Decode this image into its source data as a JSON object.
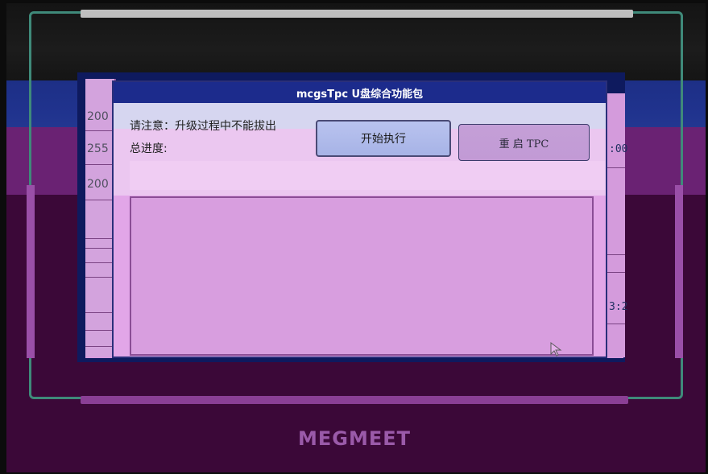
{
  "dialog": {
    "title": "mcgsTpc U盘综合功能包",
    "warning": "请注意：升级过程中不能拔出",
    "progress_label": "总进度:",
    "start_button": "开始执行",
    "restart_button": "重 启 TPC"
  },
  "left_strip": [
    "200",
    "255",
    "200"
  ],
  "right_strip": [
    ":00",
    "3:2"
  ],
  "device": {
    "brand": "MEGMEET"
  },
  "icons": [
    "mouse-cursor-icon"
  ]
}
